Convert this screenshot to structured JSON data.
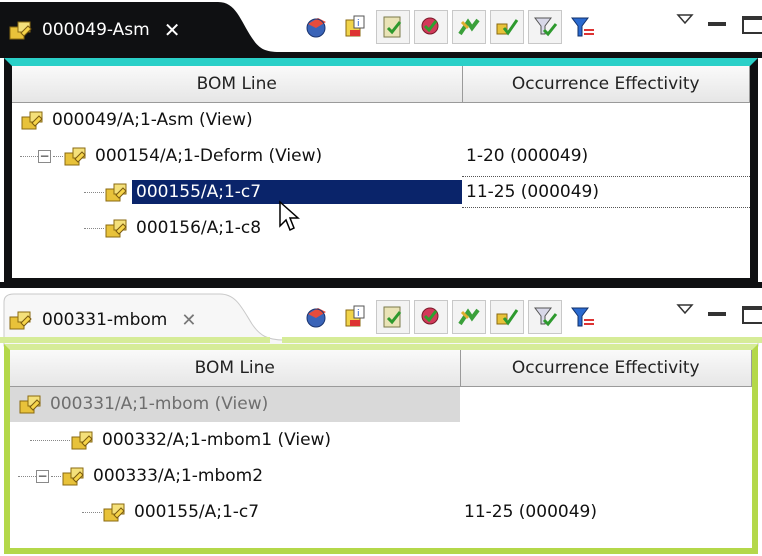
{
  "panes": [
    {
      "tab_title": "000049-Asm",
      "tab_close_glyph": "✕",
      "active": true,
      "columns": [
        "BOM Line",
        "Occurrence Effectivity"
      ],
      "rows": [
        {
          "label": "000049/A;1-Asm (View)",
          "effectivity": "",
          "depth": 0,
          "expander": "",
          "selected": false
        },
        {
          "label": "000154/A;1-Deform (View)",
          "effectivity": "1-20 (000049)",
          "depth": 1,
          "expander": "−",
          "selected": false
        },
        {
          "label": "000155/A;1-c7",
          "effectivity": "11-25 (000049)",
          "depth": 2,
          "expander": "",
          "selected": true
        },
        {
          "label": "000156/A;1-c8",
          "effectivity": "",
          "depth": 2,
          "expander": "",
          "selected": false
        }
      ]
    },
    {
      "tab_title": "000331-mbom",
      "tab_close_glyph": "✕",
      "active": false,
      "columns": [
        "BOM Line",
        "Occurrence Effectivity"
      ],
      "rows": [
        {
          "label": "000331/A;1-mbom (View)",
          "effectivity": "",
          "depth": 0,
          "expander": "",
          "selected": false
        },
        {
          "label": "000332/A;1-mbom1 (View)",
          "effectivity": "",
          "depth": 1,
          "expander": "",
          "selected": false
        },
        {
          "label": "000333/A;1-mbom2",
          "effectivity": "",
          "depth": 1,
          "expander": "−",
          "selected": false
        },
        {
          "label": "000155/A;1-c7",
          "effectivity": "11-25 (000049)",
          "depth": 2,
          "expander": "",
          "selected": false
        }
      ]
    }
  ],
  "toolbar_icons": [
    "cube-globe-icon",
    "info-document-icon",
    "clipboard-check-icon",
    "red-gem-check-icon",
    "green-arrows-icon",
    "yellow-check-icon",
    "funnel-check-icon",
    "blue-filter-icon"
  ],
  "colors": {
    "active_tab_bg": "#0f1012",
    "active_tab_accent": "#2ad0c8",
    "inactive_tab_accent": "#b4d84a",
    "selection": "#0a246a"
  }
}
